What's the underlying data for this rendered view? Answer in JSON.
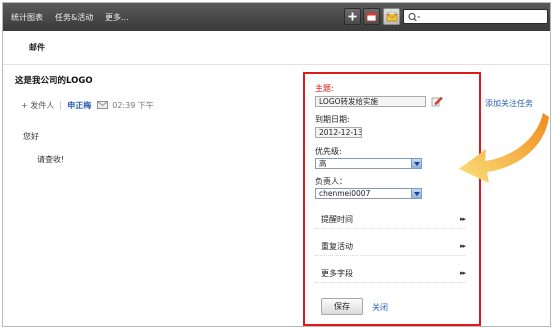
{
  "nav": {
    "items": [
      "统计图表",
      "任务&活动",
      "更多..."
    ]
  },
  "toolbar": {
    "buttons": [
      {
        "icon": "add-icon"
      },
      {
        "icon": "calendar-icon"
      },
      {
        "icon": "mail-icon",
        "active": true
      }
    ],
    "search_icon": "search-icon",
    "search_placeholder": "Q-"
  },
  "subhead": {
    "title": "邮件"
  },
  "email": {
    "subject": "这是我公司的LOGO",
    "sender_prefix": "+ 发件人",
    "sender": "申正梅",
    "time": "02:39 下午",
    "greeting": "您好",
    "body": "请查收!"
  },
  "task_panel": {
    "subject_label": "主题:",
    "subject_value": "LOGO转发给实施",
    "due_label": "到期日期:",
    "due_value": "2012-12-13",
    "priority_label": "优先级:",
    "priority_value": "高",
    "owner_label": "负责人：",
    "owner_value": "chenmei0007",
    "sections": [
      "提醒时间",
      "重复活动",
      "更多字段"
    ],
    "save_label": "保存",
    "close_label": "关闭"
  },
  "follow_link": "添加关注任务",
  "colors": {
    "highlight_border": "#e0191b",
    "link": "#2a5db0",
    "arrow": "#f4a623"
  }
}
